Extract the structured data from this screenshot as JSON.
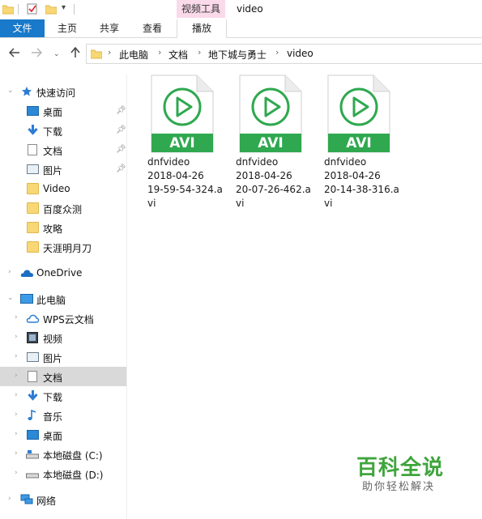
{
  "window": {
    "title": "video",
    "context_tab_group": "视频工具"
  },
  "ribbon": {
    "tabs": [
      {
        "label": "文件"
      },
      {
        "label": "主页"
      },
      {
        "label": "共享"
      },
      {
        "label": "查看"
      },
      {
        "label": "播放"
      }
    ]
  },
  "address": {
    "crumbs": [
      "此电脑",
      "文档",
      "地下城与勇士",
      "video"
    ]
  },
  "nav": {
    "quick_access": "快速访问",
    "quick_items": [
      {
        "label": "桌面",
        "icon": "desktop-icon",
        "pinned": true
      },
      {
        "label": "下载",
        "icon": "download-icon",
        "pinned": true
      },
      {
        "label": "文档",
        "icon": "document-icon",
        "pinned": true
      },
      {
        "label": "图片",
        "icon": "pictures-icon",
        "pinned": true
      },
      {
        "label": "Video",
        "icon": "folder-icon",
        "pinned": false
      },
      {
        "label": "百度众测",
        "icon": "folder-icon",
        "pinned": false
      },
      {
        "label": "攻略",
        "icon": "folder-icon",
        "pinned": false
      },
      {
        "label": "天涯明月刀",
        "icon": "folder-icon",
        "pinned": false
      }
    ],
    "onedrive": "OneDrive",
    "this_pc": "此电脑",
    "pc_items": [
      {
        "label": "WPS云文档",
        "icon": "cloud-icon"
      },
      {
        "label": "视频",
        "icon": "video-icon"
      },
      {
        "label": "图片",
        "icon": "pictures-icon"
      },
      {
        "label": "文档",
        "icon": "document-icon",
        "selected": true
      },
      {
        "label": "下载",
        "icon": "download-icon"
      },
      {
        "label": "音乐",
        "icon": "music-icon"
      },
      {
        "label": "桌面",
        "icon": "desktop-icon"
      },
      {
        "label": "本地磁盘 (C:)",
        "icon": "drive-icon"
      },
      {
        "label": "本地磁盘 (D:)",
        "icon": "drive-icon"
      }
    ],
    "network": "网络"
  },
  "files": [
    {
      "badge": "AVI",
      "name_lines": [
        "dnfvideo",
        "2018-04-26",
        "19-59-54-324.a",
        "vi"
      ]
    },
    {
      "badge": "AVI",
      "name_lines": [
        "dnfvideo",
        "2018-04-26",
        "20-07-26-462.a",
        "vi"
      ]
    },
    {
      "badge": "AVI",
      "name_lines": [
        "dnfvideo",
        "2018-04-26",
        "20-14-38-316.a",
        "vi"
      ]
    }
  ],
  "watermark": {
    "title": "百科全说",
    "subtitle": "助你轻松解决"
  },
  "colors": {
    "file_tab": "#1979ca",
    "context_tab": "#f9d9ea",
    "avi_green": "#2fa84f",
    "selection": "#d9d9d9",
    "watermark_green": "#3fa53c"
  }
}
